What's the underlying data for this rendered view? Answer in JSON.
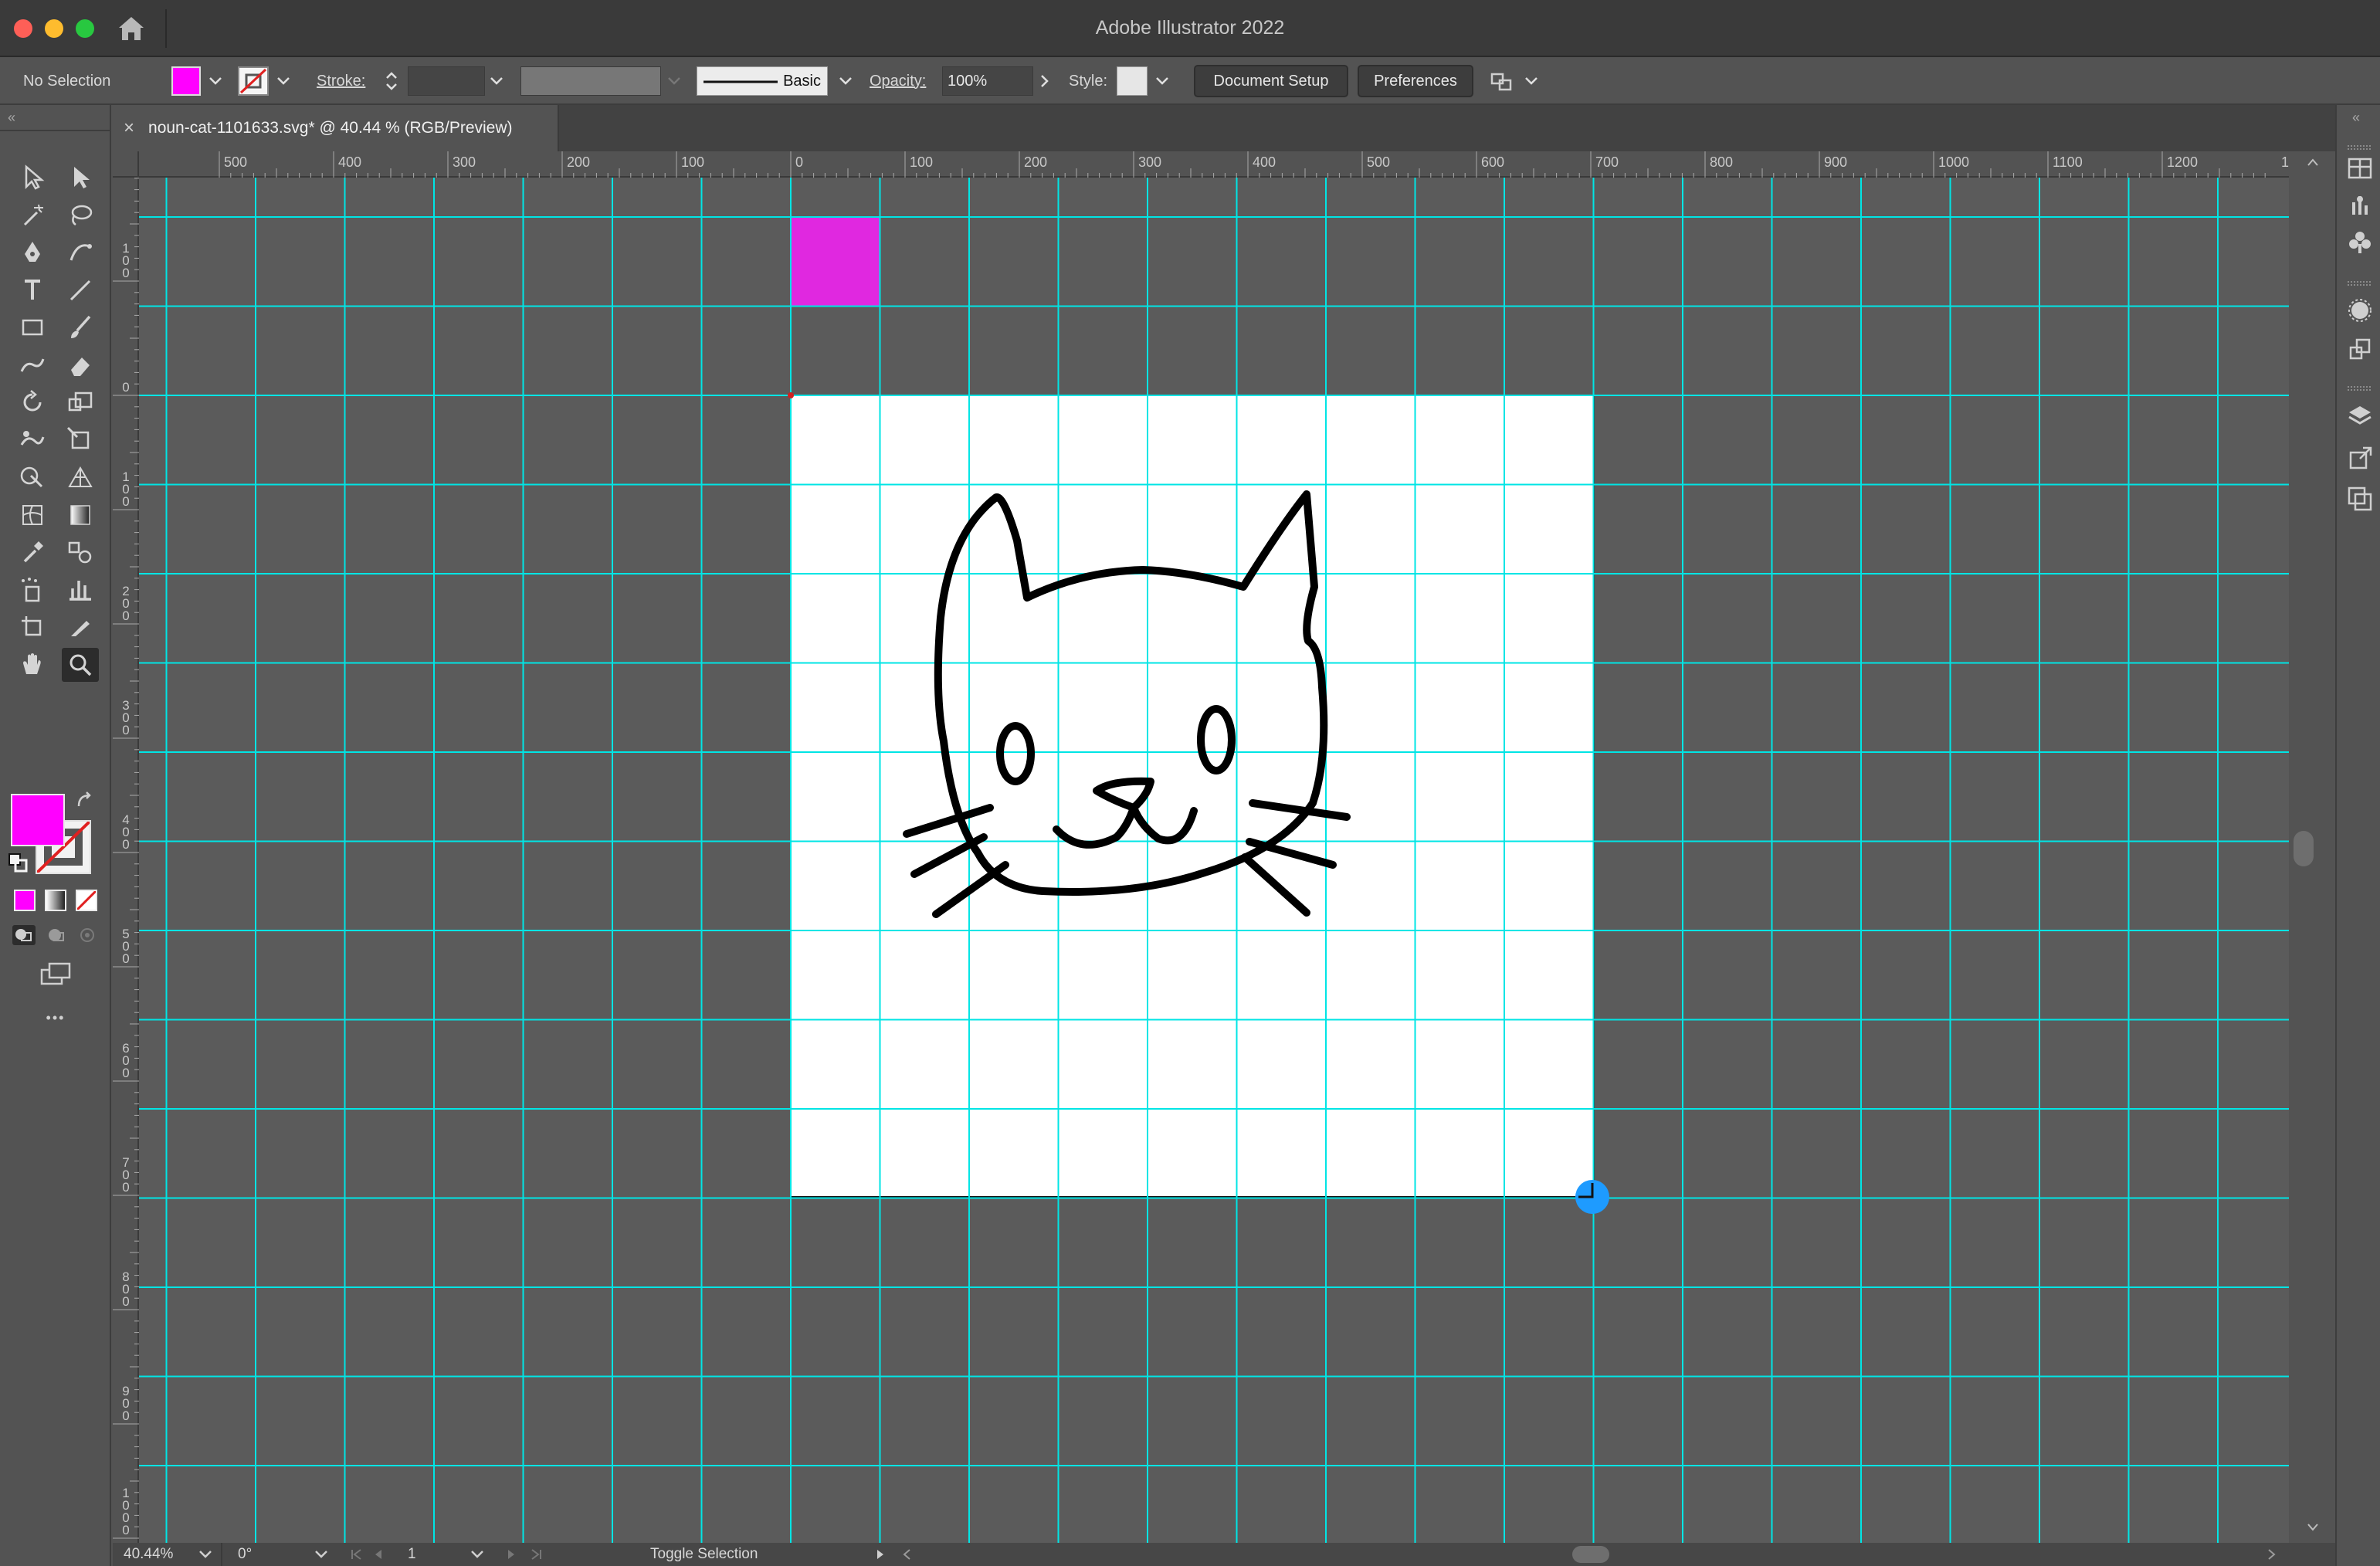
{
  "window": {
    "title": "Adobe Illustrator 2022"
  },
  "control_bar": {
    "selection_status": "No Selection",
    "stroke_label": "Stroke:",
    "stroke_value": "",
    "brush_label": "Basic",
    "opacity_label": "Opacity:",
    "opacity_value": "100%",
    "style_label": "Style:",
    "document_setup_button": "Document Setup",
    "preferences_button": "Preferences",
    "fill_color": "#ff00ff"
  },
  "document_tab": {
    "close_glyph": "×",
    "label": "noun-cat-1101633.svg* @ 40.44 % (RGB/Preview)"
  },
  "rulers": {
    "horizontal": [
      "500",
      "400",
      "300",
      "200",
      "100",
      "0",
      "100",
      "200",
      "300",
      "400",
      "500",
      "600",
      "700",
      "800",
      "900",
      "1000",
      "1100",
      "1200",
      "1"
    ],
    "vertical": [
      "1\n0\n0",
      "0",
      "1\n0\n0",
      "2\n0\n0",
      "3\n0\n0",
      "4\n0\n0",
      "5\n0\n0",
      "6\n0\n0",
      "7\n0\n0",
      "8\n0\n0",
      "9\n0\n0",
      "1\n0\n0\n0"
    ]
  },
  "canvas": {
    "grid_color": "#00e5e5",
    "artboard_color": "#ffffff",
    "swatch_color": "#e028e0",
    "artwork": "cat-face-outline"
  },
  "toolbar": {
    "tools": [
      "selection-tool",
      "direct-selection-tool",
      "magic-wand-tool",
      "lasso-tool",
      "pen-tool",
      "curvature-tool",
      "type-tool",
      "line-segment-tool",
      "rectangle-tool",
      "paintbrush-tool",
      "shaper-tool",
      "eraser-tool",
      "rotate-tool",
      "scale-tool",
      "warp-tool",
      "free-transform-tool",
      "shape-builder-tool",
      "perspective-grid-tool",
      "mesh-tool",
      "gradient-tool",
      "eyedropper-tool",
      "blend-tool",
      "symbol-sprayer-tool",
      "column-graph-tool",
      "artboard-tool",
      "slice-tool",
      "hand-tool",
      "zoom-tool"
    ],
    "more_glyph": "•••"
  },
  "right_panel": {
    "icons": [
      "properties-icon",
      "libraries-icon",
      "symbols-icon",
      "appearance-icon",
      "transform-icon",
      "layers-icon",
      "export-icon",
      "pathfinder-icon"
    ]
  },
  "status_bar": {
    "zoom": "40.44%",
    "rotation": "0°",
    "artboard_number": "1",
    "status_text": "Toggle Selection"
  }
}
